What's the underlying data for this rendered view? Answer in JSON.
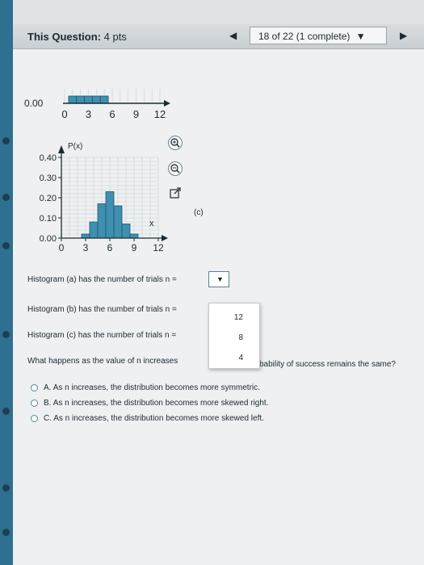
{
  "header": {
    "title_label": "This Question:",
    "title_value": "4 pts",
    "nav_text": "18 of 22 (1 complete)",
    "nav_arrow_left": "◀",
    "nav_arrow_right": "▶",
    "nav_caret": "▼"
  },
  "charts": {
    "top_chart": {
      "y_tick_label": "0.00",
      "x_tick_labels": [
        "0",
        "3",
        "6",
        "9",
        "12"
      ]
    },
    "bottom_chart": {
      "y_axis_label": "P(x)",
      "x_axis_label": "x",
      "y_tick_labels": [
        "0.40",
        "0.30",
        "0.20",
        "0.10",
        "0.00"
      ],
      "x_tick_labels": [
        "0",
        "3",
        "6",
        "9",
        "12"
      ],
      "part_label": "(c)"
    }
  },
  "chart_data": [
    {
      "type": "bar",
      "categories": [
        "0",
        "1",
        "2",
        "3",
        "4",
        "5",
        "6",
        "7",
        "8",
        "9",
        "10",
        "11",
        "12"
      ],
      "values": [
        0.0,
        0.01,
        0.01,
        0.01,
        0.01,
        0.01,
        0.0,
        0.0,
        0.0,
        0.0,
        0.0,
        0.0,
        0.0
      ],
      "ylim": [
        0,
        0.02
      ],
      "xlim": [
        0,
        12
      ]
    },
    {
      "type": "bar",
      "title": "",
      "xlabel": "x",
      "ylabel": "P(x)",
      "categories": [
        "0",
        "1",
        "2",
        "3",
        "4",
        "5",
        "6",
        "7",
        "8",
        "9",
        "10",
        "11",
        "12"
      ],
      "values": [
        0.0,
        0.0,
        0.0,
        0.02,
        0.08,
        0.17,
        0.23,
        0.16,
        0.07,
        0.02,
        0.0,
        0.0,
        0.0
      ],
      "ylim": [
        0,
        0.4
      ],
      "xlim": [
        0,
        12
      ],
      "grid": true
    }
  ],
  "questions": {
    "q_a": "Histogram (a) has the number of trials n =",
    "q_b": "Histogram (b) has the number of trials n =",
    "q_c": "Histogram (c) has the number of trials n =",
    "q_main_left": "What happens as the value of n increases",
    "q_main_right": "bability of success remains the same?",
    "dropdown_arrow": "▼",
    "dropdown_options": [
      "12",
      "8",
      "4"
    ]
  },
  "options": [
    {
      "letter": "A.",
      "text": "As n increases, the distribution becomes more symmetric."
    },
    {
      "letter": "B.",
      "text": "As n increases, the distribution becomes more skewed right."
    },
    {
      "letter": "C.",
      "text": "As n increases, the distribution becomes more skewed left."
    }
  ],
  "colors": {
    "bar_fill": "#3f8fb0",
    "bar_stroke": "#1e5470",
    "grid": "#c9d1d6",
    "axis": "#1b2a33",
    "accent": "#2f6f8f"
  }
}
